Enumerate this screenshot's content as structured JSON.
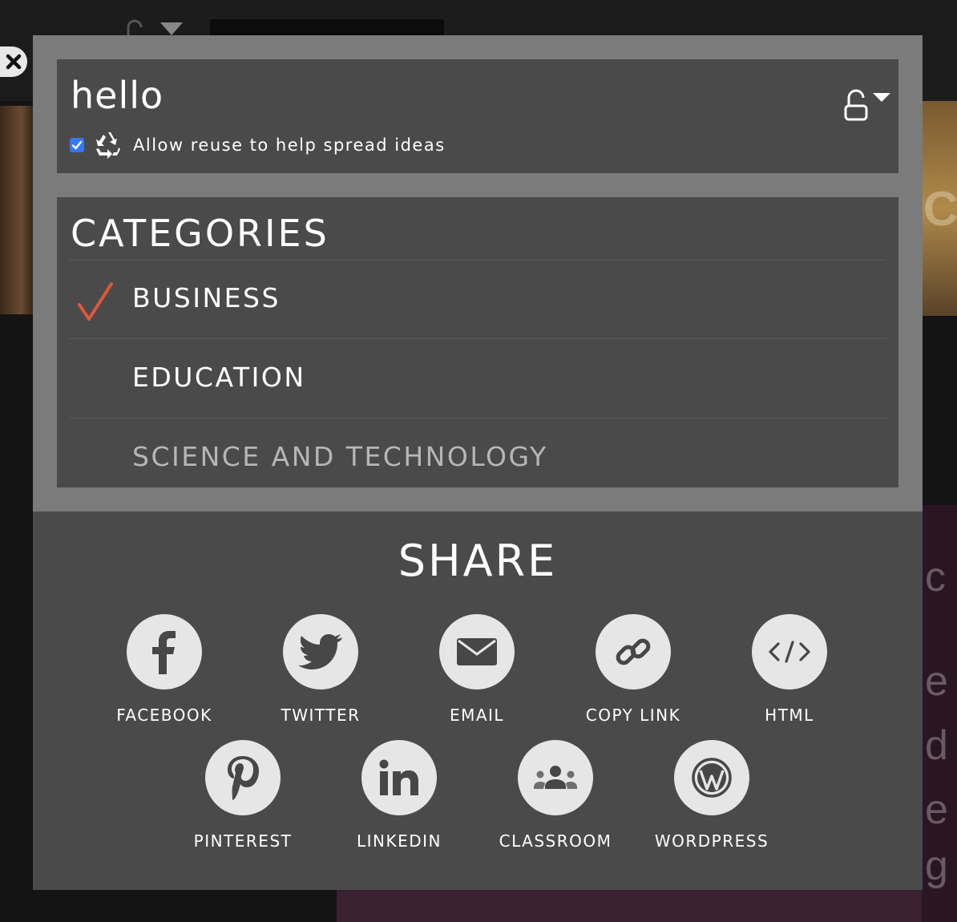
{
  "dialog": {
    "title": "hello",
    "reuse_checked": true,
    "reuse_label": "Allow reuse to help spread ideas",
    "privacy_icon": "unlock-icon"
  },
  "categories": {
    "heading": "CATEGORIES",
    "items": [
      {
        "label": "BUSINESS",
        "selected": true
      },
      {
        "label": "EDUCATION",
        "selected": false
      },
      {
        "label": "SCIENCE AND TECHNOLOGY",
        "selected": false
      }
    ]
  },
  "share": {
    "heading": "SHARE",
    "buttons": [
      {
        "label": "FACEBOOK",
        "icon": "facebook-icon"
      },
      {
        "label": "TWITTER",
        "icon": "twitter-icon"
      },
      {
        "label": "EMAIL",
        "icon": "email-icon"
      },
      {
        "label": "COPY LINK",
        "icon": "link-icon"
      },
      {
        "label": "HTML",
        "icon": "code-icon"
      },
      {
        "label": "PINTEREST",
        "icon": "pinterest-icon"
      },
      {
        "label": "LINKEDIN",
        "icon": "linkedin-icon"
      },
      {
        "label": "CLASSROOM",
        "icon": "classroom-icon"
      },
      {
        "label": "WORDPRESS",
        "icon": "wordpress-icon"
      }
    ]
  },
  "colors": {
    "overlay_frame": "#7b7b7b",
    "panel": "#4a4a4a",
    "check_accent": "#e0563a",
    "checkbox_blue": "#3478f6"
  }
}
